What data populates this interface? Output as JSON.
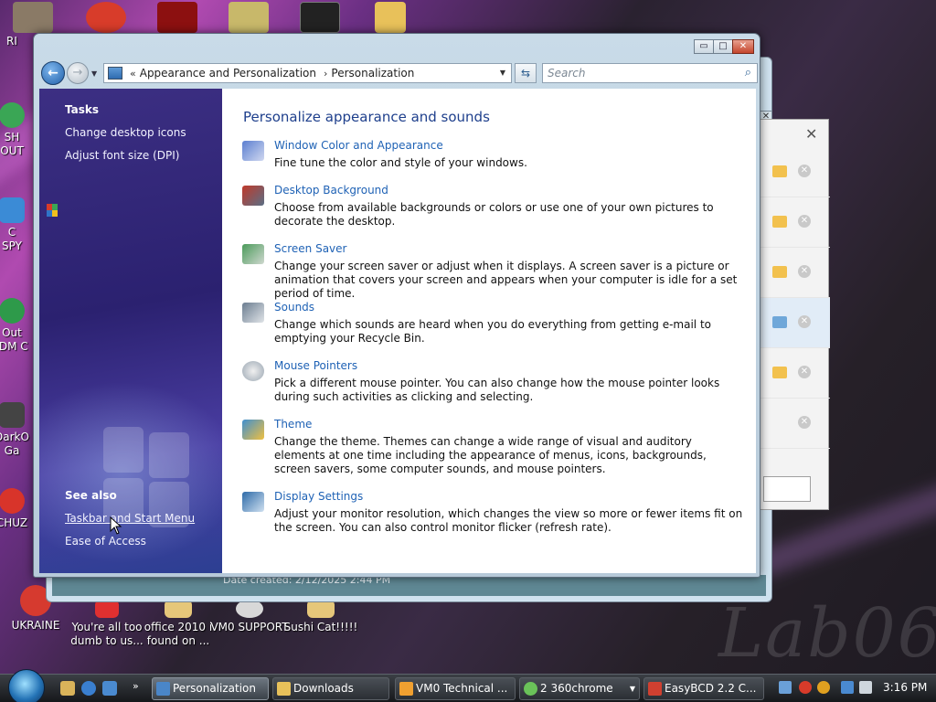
{
  "window": {
    "address_crumbs": [
      "Appearance and Personalization",
      "Personalization"
    ],
    "address_prefix": "«",
    "search_placeholder": "Search",
    "caption": {
      "minimize": "▭",
      "maximize": "□",
      "close": "✕"
    }
  },
  "sidebar": {
    "tasks_heading": "Tasks",
    "tasks": [
      "Change desktop icons",
      "Adjust font size (DPI)"
    ],
    "see_also_heading": "See also",
    "see_also": [
      "Taskbar and Start Menu",
      "Ease of Access"
    ]
  },
  "content": {
    "heading": "Personalize appearance and sounds",
    "items": [
      {
        "title": "Window Color and Appearance",
        "desc": "Fine tune the color and style of your windows.",
        "icon": "window-color-icon",
        "color": "#5b7fd0"
      },
      {
        "title": "Desktop Background",
        "desc": "Choose from available backgrounds or colors or use one of your own pictures to decorate the desktop.",
        "icon": "desktop-background-icon",
        "color": "#c0392b"
      },
      {
        "title": "Screen Saver",
        "desc": "Change your screen saver or adjust when it displays. A screen saver is a picture or animation that covers your screen and appears when your computer is idle for a set period of time.",
        "icon": "screen-saver-icon",
        "color": "#4a9a5a"
      },
      {
        "title": "Sounds",
        "desc": "Change which sounds are heard when you do everything from getting e-mail to emptying your Recycle Bin.",
        "icon": "sounds-icon",
        "color": "#6b7d90"
      },
      {
        "title": "Mouse Pointers",
        "desc": "Pick a different mouse pointer. You can also change how the mouse pointer looks during such activities as clicking and selecting.",
        "icon": "mouse-pointer-icon",
        "color": "#9aa6b2"
      },
      {
        "title": "Theme",
        "desc": "Change the theme. Themes can change a wide range of visual and auditory elements at one time including the appearance of menus, icons, backgrounds, screen savers, some computer sounds, and mouse pointers.",
        "icon": "theme-icon",
        "color": "#3f8fd0"
      },
      {
        "title": "Display Settings",
        "desc": "Adjust your monitor resolution, which changes the view so more or fewer items fit on the screen. You can also control monitor flicker (refresh rate).",
        "icon": "display-settings-icon",
        "color": "#2d6aa8"
      }
    ]
  },
  "background_window": {
    "status": "Date created: 2/12/2025 2:44 PM"
  },
  "desktop": {
    "left_labels": [
      "RI",
      "SH",
      "OUT",
      "C",
      "SPY",
      "Out",
      "IDM C",
      "DarkO",
      "Ga",
      "CHUZ"
    ],
    "bottom_icons": [
      {
        "label": "UKRAINE",
        "color": "#d63a2f"
      },
      {
        "label": "You're all too dumb to us...",
        "color": "#e03030"
      },
      {
        "label": "office 2010 i found on ...",
        "color": "#e6c77a"
      },
      {
        "label": "VM0 SUPPORT",
        "color": "#d8d8d8"
      },
      {
        "label": "Sushi Cat!!!!!",
        "color": "#e6c77a"
      }
    ],
    "watermark": "Lab06"
  },
  "taskbar": {
    "buttons": [
      {
        "label": "Personalization",
        "active": true,
        "color": "#4a86c8"
      },
      {
        "label": "Downloads",
        "active": false,
        "color": "#e8c15a"
      },
      {
        "label": "VM0 Technical ...",
        "active": false,
        "color": "#f0a030"
      },
      {
        "label": "2 360chrome",
        "active": false,
        "color": "#6ac259"
      },
      {
        "label": "EasyBCD 2.2 C...",
        "active": false,
        "color": "#d04030"
      }
    ],
    "clock": "3:16 PM",
    "chevron": "»"
  }
}
